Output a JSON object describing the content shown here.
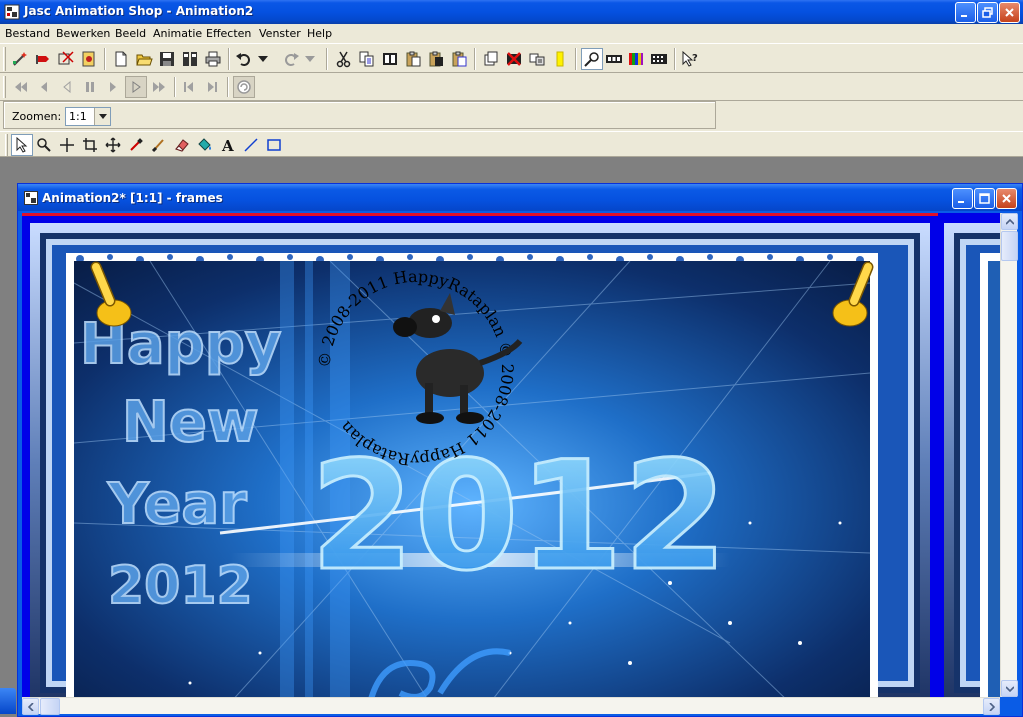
{
  "app": {
    "title": "Jasc Animation Shop - Animation2"
  },
  "menu": [
    "Bestand",
    "Bewerken",
    "Beeld",
    "Animatie",
    "Effecten",
    "Venster",
    "Help"
  ],
  "zoom": {
    "label": "Zoomen:",
    "value": "1:1"
  },
  "document": {
    "title": "Animation2* [1:1] - frames"
  },
  "artwork": {
    "greeting_lines": [
      "Happy",
      "New",
      "Year",
      "2012"
    ],
    "big_year": "2012",
    "watermark_text": "© 2008-2011  HappyRataplan  © 2008-2011  HappyRataplan"
  },
  "colors": {
    "titlebar": "#0551e0",
    "chrome": "#ece9d8",
    "canvas_bg": "#0000e8",
    "frame_marker": "#e0102a"
  }
}
